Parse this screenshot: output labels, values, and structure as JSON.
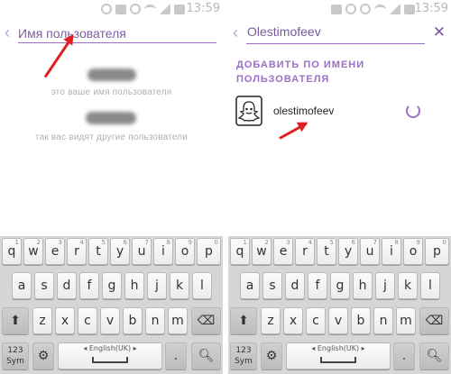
{
  "status_bar": {
    "time": "13:59",
    "icons": [
      "battery-saver-icon",
      "notification-icon",
      "sync-icon",
      "alarm-icon",
      "wifi-icon",
      "signal-icon",
      "battery-icon"
    ]
  },
  "left_screen": {
    "search": {
      "placeholder": "Имя пользователя",
      "back_icon": "chevron-left-icon"
    },
    "username_caption": "это ваше имя пользователя",
    "display_name_caption": "так вас видят другие пользователи"
  },
  "right_screen": {
    "search": {
      "value": "Olestimofeev",
      "back_icon": "chevron-left-icon",
      "clear_icon": "close-icon"
    },
    "section_header": "ДОБАВИТЬ ПО ИМЕНИ ПОЛЬЗОВАТЕЛЯ",
    "result": {
      "username": "olestimofeev",
      "avatar_icon": "snapchat-ghost-icon",
      "action_icon": "loading-spinner-icon"
    }
  },
  "keyboard": {
    "row1": [
      "q",
      "w",
      "e",
      "r",
      "t",
      "y",
      "u",
      "i",
      "o",
      "p"
    ],
    "row1_alt": [
      "1",
      "2",
      "3",
      "4",
      "5",
      "6",
      "7",
      "8",
      "9",
      "0"
    ],
    "row2": [
      "a",
      "s",
      "d",
      "f",
      "g",
      "h",
      "j",
      "k",
      "l"
    ],
    "row3": [
      "z",
      "x",
      "c",
      "v",
      "b",
      "n",
      "m"
    ],
    "symbols_key": "123\nSym",
    "language_label": "English(UK)",
    "language_prev": "◂",
    "language_next": "▸",
    "shift_icon": "shift-arrow-icon",
    "backspace_icon": "backspace-icon",
    "settings_icon": "gear-icon",
    "search_icon": "search-icon"
  },
  "colors": {
    "accent": "#9b6fc5",
    "annotation_arrow": "#e02020",
    "keyboard_bg": "#d6d6d6"
  }
}
